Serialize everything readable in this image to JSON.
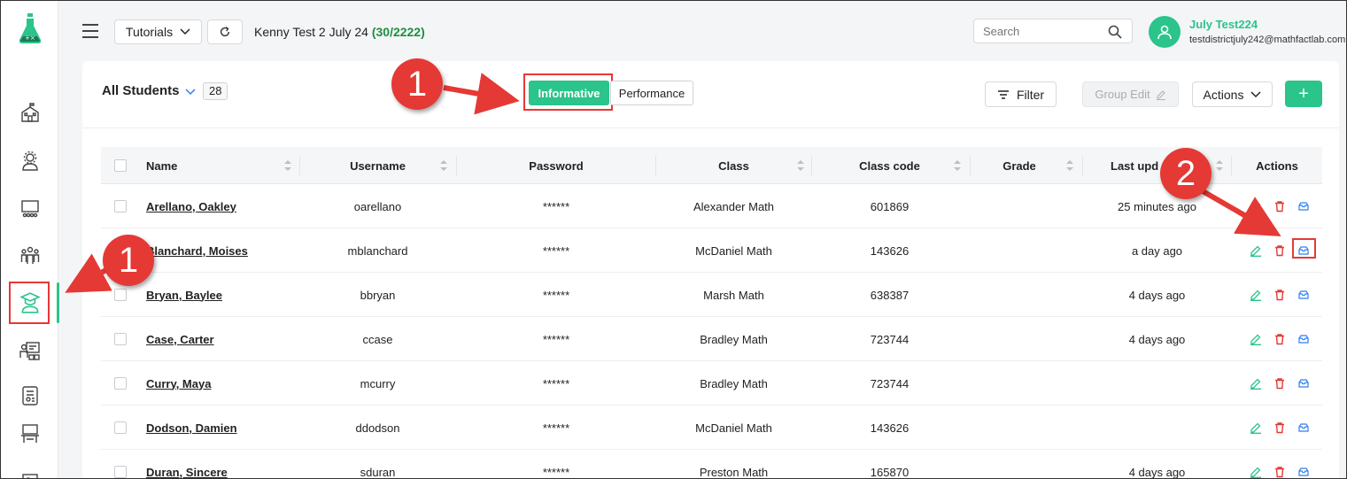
{
  "topbar": {
    "tutorials_label": "Tutorials",
    "district_name": "Kenny Test 2 July 24",
    "district_count": "(30/2222)",
    "search_placeholder": "Search",
    "user_name": "July Test224",
    "user_email": "testdistrictjuly242@mathfactlab.com"
  },
  "sidebar": {
    "icons": [
      "logo-icon",
      "school-icon",
      "district-admin-icon",
      "classroom-icon",
      "users-group-icon",
      "student-icon",
      "teacher-board-icon",
      "report-icon",
      "desk-icon"
    ]
  },
  "header": {
    "all_students_label": "All Students",
    "count": "28",
    "informative_label": "Informative",
    "performance_label": "Performance",
    "filter_label": "Filter",
    "group_edit_label": "Group Edit",
    "actions_label": "Actions",
    "add_label": "+"
  },
  "table": {
    "columns": [
      "Name",
      "Username",
      "Password",
      "Class",
      "Class code",
      "Grade",
      "Last upd",
      "Actions"
    ],
    "rows": [
      {
        "name": "Arellano, Oakley",
        "username": "oarellano",
        "password": "******",
        "class": "Alexander Math",
        "class_code": "601869",
        "grade": "",
        "last_updated": "25 minutes ago"
      },
      {
        "name": "Blanchard, Moises",
        "username": "mblanchard",
        "password": "******",
        "class": "McDaniel Math",
        "class_code": "143626",
        "grade": "",
        "last_updated": "a day ago"
      },
      {
        "name": "Bryan, Baylee",
        "username": "bbryan",
        "password": "******",
        "class": "Marsh Math",
        "class_code": "638387",
        "grade": "",
        "last_updated": "4 days ago"
      },
      {
        "name": "Case, Carter",
        "username": "ccase",
        "password": "******",
        "class": "Bradley Math",
        "class_code": "723744",
        "grade": "",
        "last_updated": "4 days ago"
      },
      {
        "name": "Curry, Maya",
        "username": "mcurry",
        "password": "******",
        "class": "Bradley Math",
        "class_code": "723744",
        "grade": "",
        "last_updated": ""
      },
      {
        "name": "Dodson, Damien",
        "username": "ddodson",
        "password": "******",
        "class": "McDaniel Math",
        "class_code": "143626",
        "grade": "",
        "last_updated": ""
      },
      {
        "name": "Duran, Sincere",
        "username": "sduran",
        "password": "******",
        "class": "Preston Math",
        "class_code": "165870",
        "grade": "",
        "last_updated": "4 days ago"
      }
    ]
  },
  "callouts": {
    "sidebar": "1",
    "toggle": "1",
    "actions": "2"
  },
  "colors": {
    "accent": "#2bc48a",
    "callout": "#e53935",
    "edit_icon": "#2bc48a",
    "delete_icon": "#e53935",
    "email_icon": "#2f80ed"
  }
}
